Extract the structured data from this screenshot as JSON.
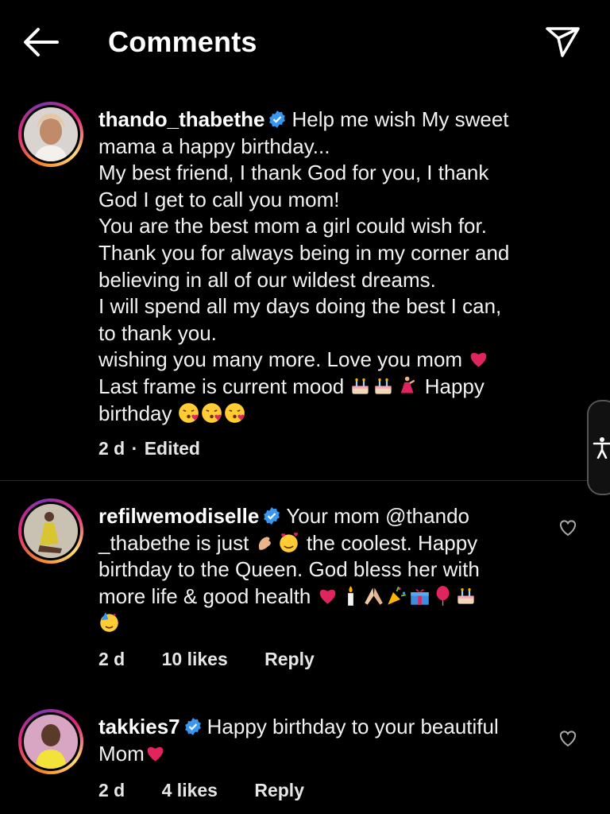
{
  "header": {
    "title": "Comments",
    "back_icon": "arrow-left-icon",
    "share_icon": "paper-plane-icon"
  },
  "comments": [
    {
      "username": "thando_thabethe",
      "verified": true,
      "lines": [
        "Help me wish My sweet",
        "mama a happy birthday...",
        "My best friend, I thank God for you, I thank",
        "God I get to call you mom!",
        "You are the best mom a girl could wish for.",
        "Thank you for always being in my corner and",
        "believing in all of our wildest dreams.",
        "I will spend all my days doing the best I can,",
        "to thank you.",
        "wishing you many more. Love you mom",
        "Last frame is current mood",
        "Happy",
        "birthday"
      ],
      "time": "2 d",
      "separator": "·",
      "edited": "Edited"
    },
    {
      "username": "refilwemodiselle",
      "verified": true,
      "lines": [
        "Your mom @thando",
        "_thabethe is just",
        "the coolest. Happy",
        "birthday to the Queen. God bless her with",
        "more life & good health"
      ],
      "time": "2 d",
      "likes": "10 likes",
      "reply": "Reply"
    },
    {
      "username": "takkies7",
      "verified": true,
      "lines": [
        "Happy birthday to your beautiful",
        "Mom"
      ],
      "time": "2 d",
      "likes": "4 likes",
      "reply": "Reply"
    }
  ],
  "colors": {
    "background": "#000000",
    "verified": "#3897f0",
    "heart": "#e0245e"
  }
}
